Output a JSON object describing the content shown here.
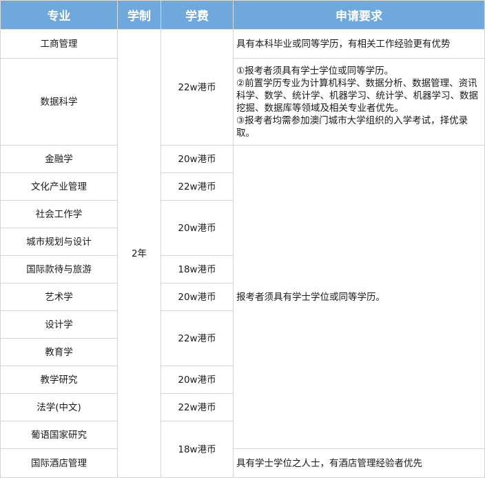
{
  "header": {
    "major": "专业",
    "duration": "学制",
    "tuition": "学费",
    "requirements": "申请要求"
  },
  "duration_value": "2年",
  "rows": [
    {
      "major": "工商管理"
    },
    {
      "major": "数据科学"
    },
    {
      "major": "金融学"
    },
    {
      "major": "文化产业管理"
    },
    {
      "major": "社会工作学"
    },
    {
      "major": "城市规划与设计"
    },
    {
      "major": "国际款待与旅游"
    },
    {
      "major": "艺术学"
    },
    {
      "major": "设计学"
    },
    {
      "major": "教育学"
    },
    {
      "major": "教学研究"
    },
    {
      "major": "法学(中文)"
    },
    {
      "major": "葡语国家研究"
    },
    {
      "major": "国际酒店管理"
    }
  ],
  "tuition_groups": [
    "22w港币",
    "20w港币",
    "22w港币",
    "20w港币",
    "18w港币",
    "20w港币",
    "22w港币",
    "20w港币",
    "22w港币",
    "18w港币"
  ],
  "requirements": {
    "business": "具有本科毕业或同等学历，有相关工作经验更有优势",
    "data_science": [
      "①报考者须具有学士学位或同等学历。",
      "②前置学历专业为计算机科学、数据分析、数据管理、资讯科学、数学、统计学、机器学习、统计学、机器学习、数据挖掘、数据库等领域及相关专业者优先。",
      "③报考者均需参加澳门城市大学组织的入学考试，择优录取。"
    ],
    "general": "报考者须具有学士学位或同等学历。",
    "hotel": "具有学士学位之人士，有酒店管理经验者优先"
  }
}
